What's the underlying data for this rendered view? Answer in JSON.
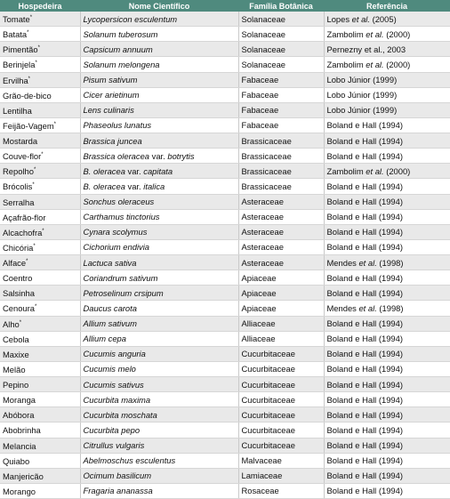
{
  "headers": [
    "Hospedeira",
    "Nome Científico",
    "Família Botânica",
    "Referência"
  ],
  "rows": [
    {
      "host": "Tomate",
      "mark": "*",
      "sci": [
        {
          "t": "Lycopersicon esculentum"
        }
      ],
      "family": "Solanaceae",
      "ref": [
        {
          "t": "Lopes "
        },
        {
          "t": "et al.",
          "i": true
        },
        {
          "t": " (2005)"
        }
      ]
    },
    {
      "host": "Batata",
      "mark": "*",
      "sci": [
        {
          "t": "Solanum tuberosum"
        }
      ],
      "family": "Solanaceae",
      "ref": [
        {
          "t": "Zambolim "
        },
        {
          "t": "et al.",
          "i": true
        },
        {
          "t": " (2000)"
        }
      ]
    },
    {
      "host": "Pimentão",
      "mark": "*",
      "sci": [
        {
          "t": "Capsicum annuum"
        }
      ],
      "family": "Solanaceae",
      "ref": [
        {
          "t": "Pernezny et al., 2003"
        }
      ]
    },
    {
      "host": "Berinjela",
      "mark": "*",
      "sci": [
        {
          "t": "Solanum melongena"
        }
      ],
      "family": "Solanaceae",
      "ref": [
        {
          "t": "Zambolim "
        },
        {
          "t": "et al.",
          "i": true
        },
        {
          "t": " (2000)"
        }
      ]
    },
    {
      "host": "Ervilha",
      "mark": "*",
      "sci": [
        {
          "t": "Pisum sativum"
        }
      ],
      "family": "Fabaceae",
      "ref": [
        {
          "t": "Lobo Júnior (1999)"
        }
      ]
    },
    {
      "host": "Grão-de-bico",
      "mark": "",
      "sci": [
        {
          "t": "Cicer arietinum"
        }
      ],
      "family": "Fabaceae",
      "ref": [
        {
          "t": "Lobo Júnior (1999)"
        }
      ]
    },
    {
      "host": "Lentilha",
      "mark": "",
      "sci": [
        {
          "t": "Lens culinaris"
        }
      ],
      "family": "Fabaceae",
      "ref": [
        {
          "t": "Lobo Júnior (1999)"
        }
      ]
    },
    {
      "host": "Feijão-Vagem",
      "mark": "*",
      "sci": [
        {
          "t": "Phaseolus lunatus"
        }
      ],
      "family": "Fabaceae",
      "ref": [
        {
          "t": "Boland e Hall (1994)"
        }
      ]
    },
    {
      "host": "Mostarda",
      "mark": "",
      "sci": [
        {
          "t": "Brassica juncea"
        }
      ],
      "family": "Brassicaceae",
      "ref": [
        {
          "t": "Boland e Hall (1994)"
        }
      ]
    },
    {
      "host": "Couve-flor",
      "mark": "*",
      "sci": [
        {
          "t": "Brassica oleracea "
        },
        {
          "t": "var.",
          "n": true
        },
        {
          "t": " botrytis"
        }
      ],
      "family": "Brassicaceae",
      "ref": [
        {
          "t": "Boland e Hall (1994)"
        }
      ]
    },
    {
      "host": "Repolho",
      "mark": "*",
      "sci": [
        {
          "t": "B. oleracea "
        },
        {
          "t": "var.",
          "n": true
        },
        {
          "t": " capitata"
        }
      ],
      "family": "Brassicaceae",
      "ref": [
        {
          "t": "Zambolim "
        },
        {
          "t": "et al.",
          "i": true
        },
        {
          "t": " (2000)"
        }
      ]
    },
    {
      "host": "Brócolis",
      "mark": "*",
      "sci": [
        {
          "t": "B. oleracea "
        },
        {
          "t": "var.",
          "n": true
        },
        {
          "t": " italica"
        }
      ],
      "family": "Brassicaceae",
      "ref": [
        {
          "t": "Boland e Hall (1994)"
        }
      ]
    },
    {
      "host": "Serralha",
      "mark": "",
      "sci": [
        {
          "t": "Sonchus oleraceus"
        }
      ],
      "family": "Asteraceae",
      "ref": [
        {
          "t": "Boland e Hall (1994)"
        }
      ]
    },
    {
      "host": "Açafrão-flor",
      "mark": "",
      "sci": [
        {
          "t": "Carthamus tinctorius"
        }
      ],
      "family": "Asteraceae",
      "ref": [
        {
          "t": "Boland e Hall (1994)"
        }
      ]
    },
    {
      "host": "Alcachofra",
      "mark": "*",
      "sci": [
        {
          "t": "Cynara scolymus"
        }
      ],
      "family": "Asteraceae",
      "ref": [
        {
          "t": "Boland e Hall (1994)"
        }
      ]
    },
    {
      "host": "Chicória",
      "mark": "*",
      "sci": [
        {
          "t": "Cichorium endivia"
        }
      ],
      "family": "Asteraceae",
      "ref": [
        {
          "t": "Boland e Hall (1994)"
        }
      ]
    },
    {
      "host": "Alface",
      "mark": "*",
      "sci": [
        {
          "t": "Lactuca sativa"
        }
      ],
      "family": "Asteraceae",
      "ref": [
        {
          "t": "Mendes "
        },
        {
          "t": "et al.",
          "i": true
        },
        {
          "t": " (1998)"
        }
      ]
    },
    {
      "host": "Coentro",
      "mark": "",
      "sci": [
        {
          "t": "Coriandrum sativum"
        }
      ],
      "family": "Apiaceae",
      "ref": [
        {
          "t": "Boland e Hall (1994)"
        }
      ]
    },
    {
      "host": "Salsinha",
      "mark": "",
      "sci": [
        {
          "t": "Petroselinum crsipum"
        }
      ],
      "family": "Apiaceae",
      "ref": [
        {
          "t": "Boland e Hall (1994)"
        }
      ]
    },
    {
      "host": "Cenoura",
      "mark": "*",
      "sci": [
        {
          "t": "Daucus carota"
        }
      ],
      "family": "Apiaceae",
      "ref": [
        {
          "t": "Mendes "
        },
        {
          "t": "et al.",
          "i": true
        },
        {
          "t": " (1998)"
        }
      ]
    },
    {
      "host": "Alho",
      "mark": "*",
      "sci": [
        {
          "t": "Allium sativum"
        }
      ],
      "family": "Alliaceae",
      "ref": [
        {
          "t": "Boland e Hall (1994)"
        }
      ]
    },
    {
      "host": "Cebola",
      "mark": "",
      "sci": [
        {
          "t": "Allium cepa"
        }
      ],
      "family": "Alliaceae",
      "ref": [
        {
          "t": "Boland e Hall (1994)"
        }
      ]
    },
    {
      "host": "Maxixe",
      "mark": "",
      "sci": [
        {
          "t": "Cucumis anguria"
        }
      ],
      "family": "Cucurbitaceae",
      "ref": [
        {
          "t": "Boland e Hall (1994)"
        }
      ]
    },
    {
      "host": "Melão",
      "mark": "",
      "sci": [
        {
          "t": "Cucumis melo"
        }
      ],
      "family": "Cucurbitaceae",
      "ref": [
        {
          "t": "Boland e Hall (1994)"
        }
      ]
    },
    {
      "host": "Pepino",
      "mark": "",
      "sci": [
        {
          "t": "Cucumis sativus"
        }
      ],
      "family": "Cucurbitaceae",
      "ref": [
        {
          "t": "Boland e Hall (1994)"
        }
      ]
    },
    {
      "host": "Moranga",
      "mark": "",
      "sci": [
        {
          "t": "Cucurbita maxima"
        }
      ],
      "family": "Cucurbitaceae",
      "ref": [
        {
          "t": "Boland e Hall (1994)"
        }
      ]
    },
    {
      "host": "Abóbora",
      "mark": "",
      "sci": [
        {
          "t": "Cucurbita moschata"
        }
      ],
      "family": "Cucurbitaceae",
      "ref": [
        {
          "t": "Boland e Hall (1994)"
        }
      ]
    },
    {
      "host": "Abobrinha",
      "mark": "",
      "sci": [
        {
          "t": "Cucurbita pepo"
        }
      ],
      "family": "Cucurbitaceae",
      "ref": [
        {
          "t": "Boland e Hall (1994)"
        }
      ]
    },
    {
      "host": "Melancia",
      "mark": "",
      "sci": [
        {
          "t": "Citrullus vulgaris"
        }
      ],
      "family": "Cucurbitaceae",
      "ref": [
        {
          "t": "Boland e Hall (1994)"
        }
      ]
    },
    {
      "host": "Quiabo",
      "mark": "",
      "sci": [
        {
          "t": "Abelmoschus esculentus"
        }
      ],
      "family": "Malvaceae",
      "ref": [
        {
          "t": "Boland e Hall (1994)"
        }
      ]
    },
    {
      "host": "Manjericão",
      "mark": "",
      "sci": [
        {
          "t": "Ocimum basilicum"
        }
      ],
      "family": "Lamiaceae",
      "ref": [
        {
          "t": "Boland e Hall (1994)"
        }
      ]
    },
    {
      "host": "Morango",
      "mark": "",
      "sci": [
        {
          "t": "Fragaria ananassa"
        }
      ],
      "family": "Rosaceae",
      "ref": [
        {
          "t": "Boland e Hall (1994)"
        }
      ]
    }
  ]
}
